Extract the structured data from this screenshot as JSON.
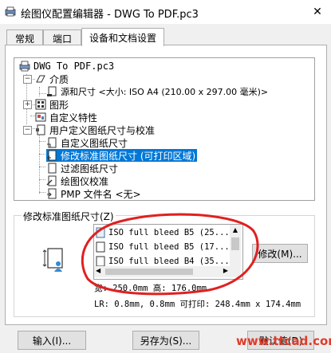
{
  "window": {
    "title": "绘图仪配置编辑器 - DWG To PDF.pc3",
    "close_glyph": "✕"
  },
  "tabs": [
    {
      "label": "常规",
      "active": false
    },
    {
      "label": "端口",
      "active": false
    },
    {
      "label": "设备和文档设置",
      "active": true
    }
  ],
  "tree": {
    "root": "DWG To PDF.pc3",
    "items": [
      {
        "label": "介质",
        "icon": "media-icon"
      },
      {
        "label": "源和尺寸 <大小: ISO A4 (210.00 x 297.00 毫米)>",
        "icon": "page-size-icon"
      },
      {
        "label": "图形",
        "icon": "graphics-icon"
      },
      {
        "label": "自定义特性",
        "icon": "custom-properties-icon"
      },
      {
        "label": "用户定义图纸尺寸与校准",
        "icon": "user-paper-icon"
      },
      {
        "label": "自定义图纸尺寸",
        "icon": "custom-paper-size-icon"
      },
      {
        "label": "修改标准图纸尺寸 (可打印区域)",
        "icon": "modify-paper-icon",
        "selected": true
      },
      {
        "label": "过滤图纸尺寸",
        "icon": "filter-paper-icon"
      },
      {
        "label": "绘图仪校准",
        "icon": "plotter-calibration-icon"
      },
      {
        "label": "PMP 文件名 <无>",
        "icon": "pmp-file-icon"
      }
    ]
  },
  "group": {
    "label": "修改标准图纸尺寸(Z)",
    "list_items": [
      "ISO full bleed B5 (25...",
      "ISO full bleed B5 (17...",
      "ISO full bleed B4 (35..."
    ],
    "modify_button": "修改(M)...",
    "size_line": "宽: 250.0mm 高: 176.0mm",
    "margin_line": "LR: 0.8mm, 0.8mm   可打印: 248.4mm x 174.4mm"
  },
  "buttons": {
    "import": "输入(I)...",
    "save_as": "另存为(S)...",
    "defaults": "默认值(D)"
  },
  "watermark": "www.ttcad.com",
  "colors": {
    "selection": "#0078d7",
    "annotation": "#e02020"
  }
}
